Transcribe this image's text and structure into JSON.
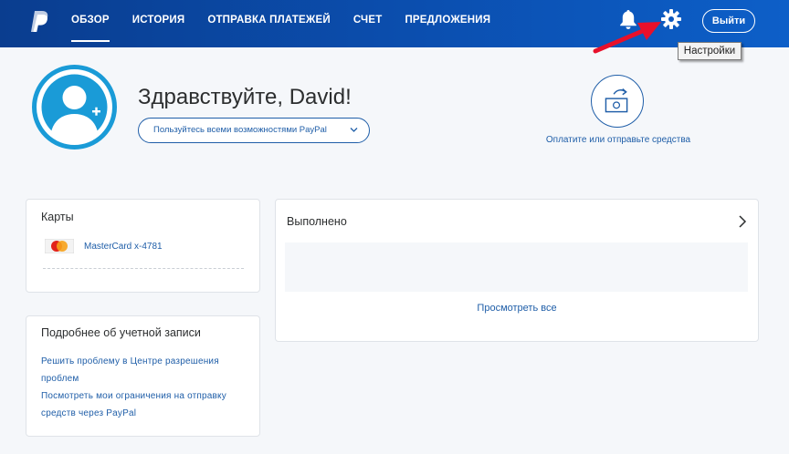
{
  "nav": {
    "items": [
      "ОБЗОР",
      "ИСТОРИЯ",
      "ОТПРАВКА ПЛАТЕЖЕЙ",
      "СЧЕТ",
      "ПРЕДЛОЖЕНИЯ"
    ],
    "active": "ОБЗОР",
    "logout_label": "Выйти",
    "tooltip": "Настройки"
  },
  "icons": {
    "logo": "paypal-logo-icon",
    "bell": "bell-icon",
    "settings": "gear-icon",
    "avatar": "avatar-add-icon",
    "send": "send-money-icon"
  },
  "profile": {
    "greeting": "Здравствуйте, David!",
    "use_all_label": "Пользуйтесь всеми возможностями PayPal",
    "send_label": "Оплатите или отправьте средства"
  },
  "cards": {
    "title": "Карты",
    "card_label": "MasterCard x-4781"
  },
  "account": {
    "title": "Подробнее об учетной записи",
    "links": [
      "Решить проблему в Центре разрешения",
      "проблем",
      "Посмотреть мои ограничения на отправку",
      "средств через PayPal"
    ]
  },
  "completed": {
    "title": "Выполнено",
    "view_all": "Просмотреть все"
  },
  "colors": {
    "header_start": "#0a3d8f",
    "header_end": "#0d5fc8",
    "link": "#1f5ea8",
    "avatar_ring": "#1a9bd7",
    "annotation_arrow": "#e8102a"
  }
}
